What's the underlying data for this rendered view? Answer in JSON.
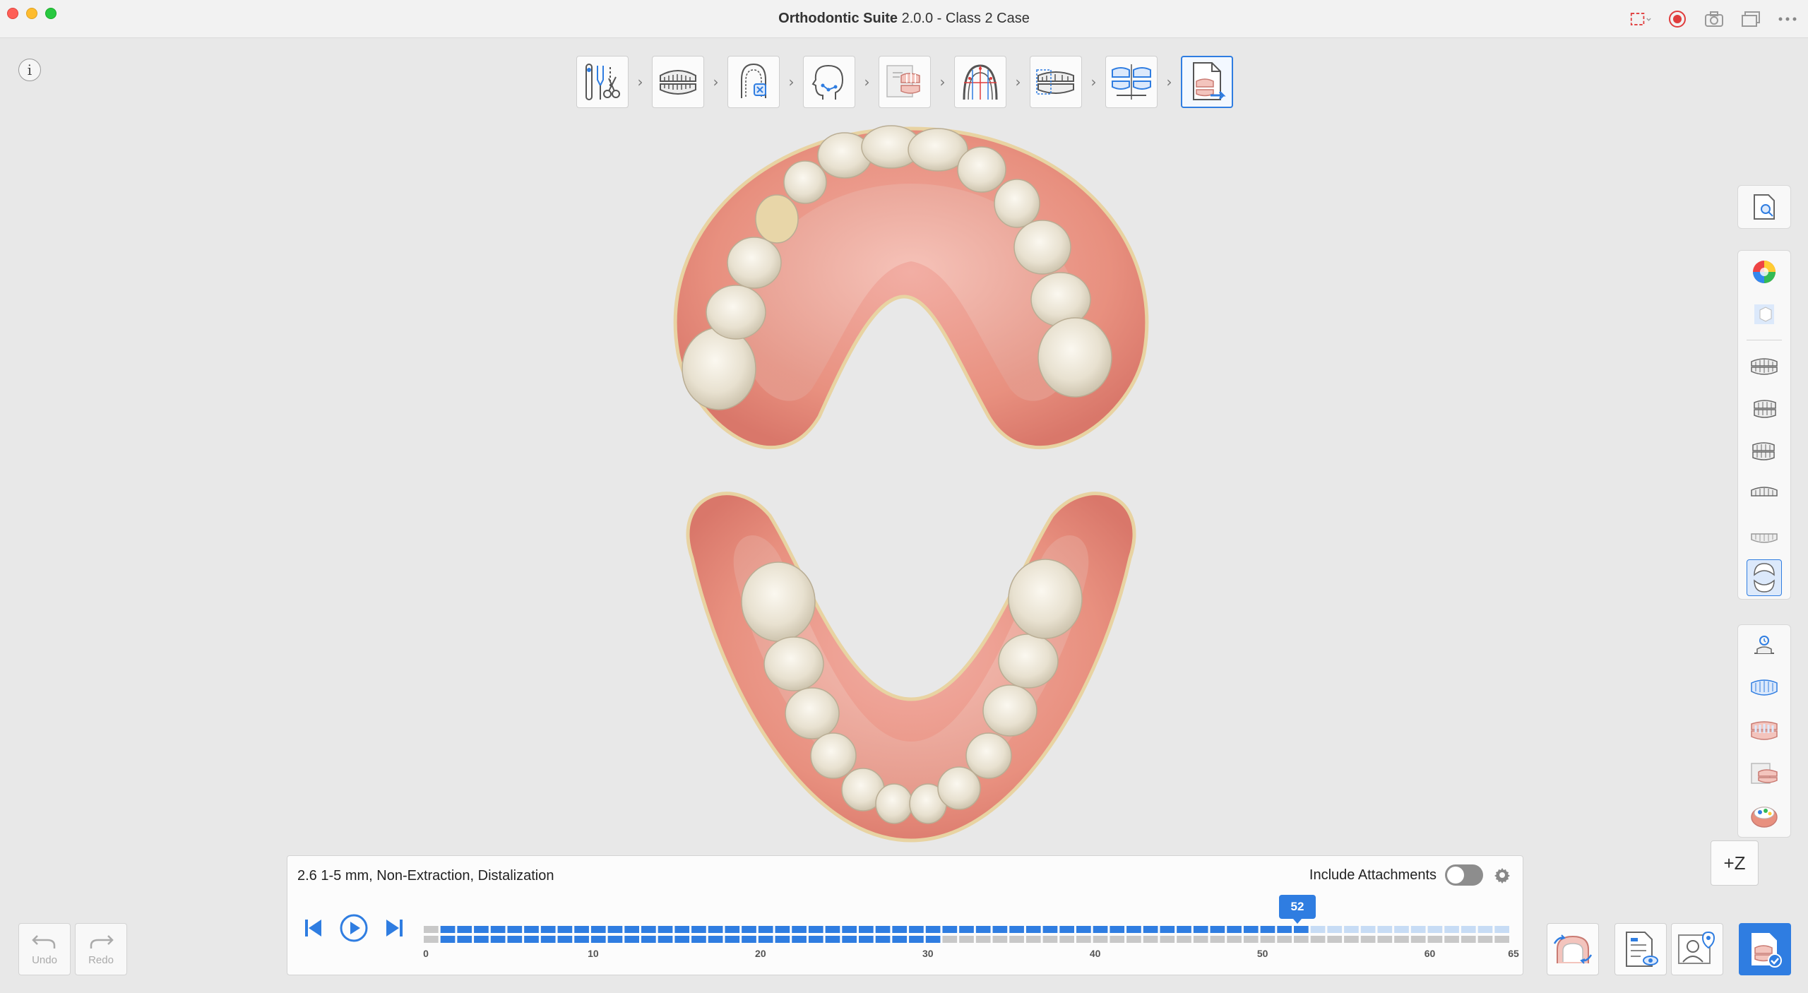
{
  "window": {
    "app_name": "Orthodontic Suite",
    "version_title": "2.0.0 - Class 2 Case"
  },
  "titlebar_icons": [
    "fullscreen-capture-icon",
    "record-icon",
    "camera-icon",
    "gallery-icon",
    "more-icon"
  ],
  "info_label": "i",
  "workflow_steps": [
    {
      "icon": "segmentation-tools-icon",
      "active": false
    },
    {
      "icon": "occlusion-setup-icon",
      "active": false
    },
    {
      "icon": "tooth-extraction-icon",
      "active": false
    },
    {
      "icon": "face-profile-icon",
      "active": false
    },
    {
      "icon": "ipr-setup-icon",
      "active": false
    },
    {
      "icon": "arch-form-icon",
      "active": false
    },
    {
      "icon": "staging-icon",
      "active": false
    },
    {
      "icon": "comparison-icon",
      "active": false
    },
    {
      "icon": "export-report-icon",
      "active": true
    }
  ],
  "right_toolbar": {
    "group1": [
      "document-search-icon"
    ],
    "group2": [
      "color-wheel-icon",
      "cube-view-icon"
    ],
    "group3": [
      "front-view-icon",
      "left-view-icon",
      "right-view-icon",
      "top-view-icon",
      "bottom-view-icon",
      "split-arch-view-icon"
    ],
    "group3_selected": 5,
    "group4": [
      "attachment-tool-icon",
      "upper-arch-icon",
      "gingiva-icon",
      "overlay-compare-icon",
      "heatmap-icon"
    ]
  },
  "zoom_axis_label": "+Z",
  "timeline": {
    "plan_label": "2.6 1-5 mm, Non-Extraction, Distalization",
    "attachments_label": "Include Attachments",
    "attachments_on": false,
    "current_stage": "52",
    "current_stage_value": 52,
    "total_stages": 65,
    "upper_active_until": 52,
    "lower_active_until": 30,
    "tick_labels": [
      "0",
      "10",
      "20",
      "30",
      "40",
      "50",
      "60",
      "65"
    ],
    "tick_values": [
      0,
      10,
      20,
      30,
      40,
      50,
      60,
      65
    ]
  },
  "undo_label": "Undo",
  "redo_label": "Redo",
  "bottom_right_icons": [
    "model-compare-icon",
    "report-preview-icon",
    "doctor-share-icon",
    "finish-export-icon"
  ],
  "colors": {
    "accent": "#2f7de1",
    "stage_active": "#2f7de1",
    "stage_upper_inactive": "#c7dcf5",
    "stage_lower_inactive": "#c8c8c8",
    "gingiva": "#e98f85",
    "tooth": "#efe9dc"
  }
}
